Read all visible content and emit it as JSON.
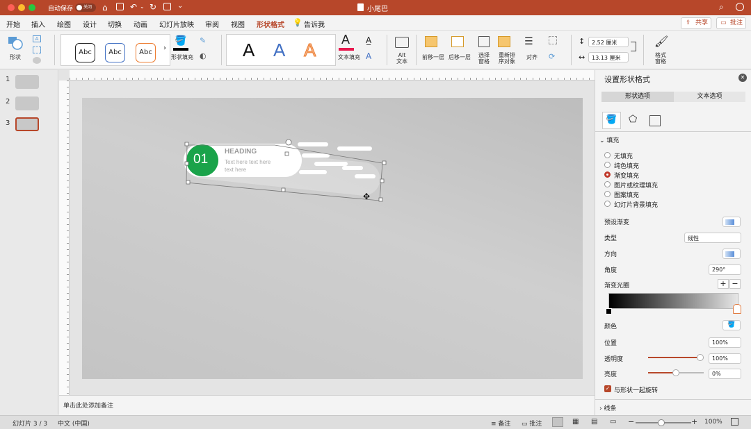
{
  "window": {
    "title": "小尾巴",
    "autosave_label": "自动保存",
    "autosave_toggle": "关闭"
  },
  "tabs": [
    "开始",
    "插入",
    "绘图",
    "设计",
    "切换",
    "动画",
    "幻灯片放映",
    "审阅",
    "视图",
    "形状格式",
    "告诉我"
  ],
  "active_tab": "形状格式",
  "share": {
    "label": "共享"
  },
  "comments": {
    "label": "批注"
  },
  "ribbon": {
    "shapes_label": "形状",
    "styles": [
      "Abc",
      "Abc",
      "Abc"
    ],
    "shape_fill_label": "形状填充",
    "wordart": [
      "A",
      "A",
      "A"
    ],
    "text_fill_label": "文本填充",
    "alt_text_label": "Alt 文本",
    "bring_forward_label": "前移一层",
    "send_backward_label": "后移一层",
    "selection_pane_label": "选择 窗格",
    "reorder_label": "重新排 序对象",
    "align_label": "对齐",
    "height_value": "2.52 厘米",
    "width_value": "13.13 厘米",
    "format_pane_label": "格式 窗格"
  },
  "slides": [
    {
      "num": "1"
    },
    {
      "num": "2"
    },
    {
      "num": "3"
    }
  ],
  "slide_content": {
    "number": "01",
    "heading": "HEADING",
    "body_line1": "Text here text here",
    "body_line2": "text here"
  },
  "notes_placeholder": "单击此处添加备注",
  "pane": {
    "title": "设置形状格式",
    "tabs": [
      "形状选项",
      "文本选项"
    ],
    "section_fill": "填充",
    "fill_options": [
      "无填充",
      "纯色填充",
      "渐变填充",
      "图片或纹理填充",
      "图案填充",
      "幻灯片背景填充"
    ],
    "fill_selected": "渐变填充",
    "preset_label": "预设渐变",
    "type_label": "类型",
    "type_value": "线性",
    "direction_label": "方向",
    "angle_label": "角度",
    "angle_value": "290°",
    "stops_label": "渐变光圈",
    "color_label": "颜色",
    "position_label": "位置",
    "position_value": "100%",
    "transparency_label": "透明度",
    "transparency_value": "100%",
    "transparency_level": 1.0,
    "brightness_label": "亮度",
    "brightness_value": "0%",
    "brightness_level": 0.5,
    "rotate_label": "与形状一起旋转",
    "section_line": "线条"
  },
  "status": {
    "slide_info": "幻灯片 3 / 3",
    "language": "中文 (中国)",
    "notes_label": "备注",
    "comments_label": "批注",
    "zoom": "100%"
  },
  "colors": {
    "brand": "#b7472a",
    "accent_green": "#1aa34a",
    "radio_on": "#c0392b"
  }
}
